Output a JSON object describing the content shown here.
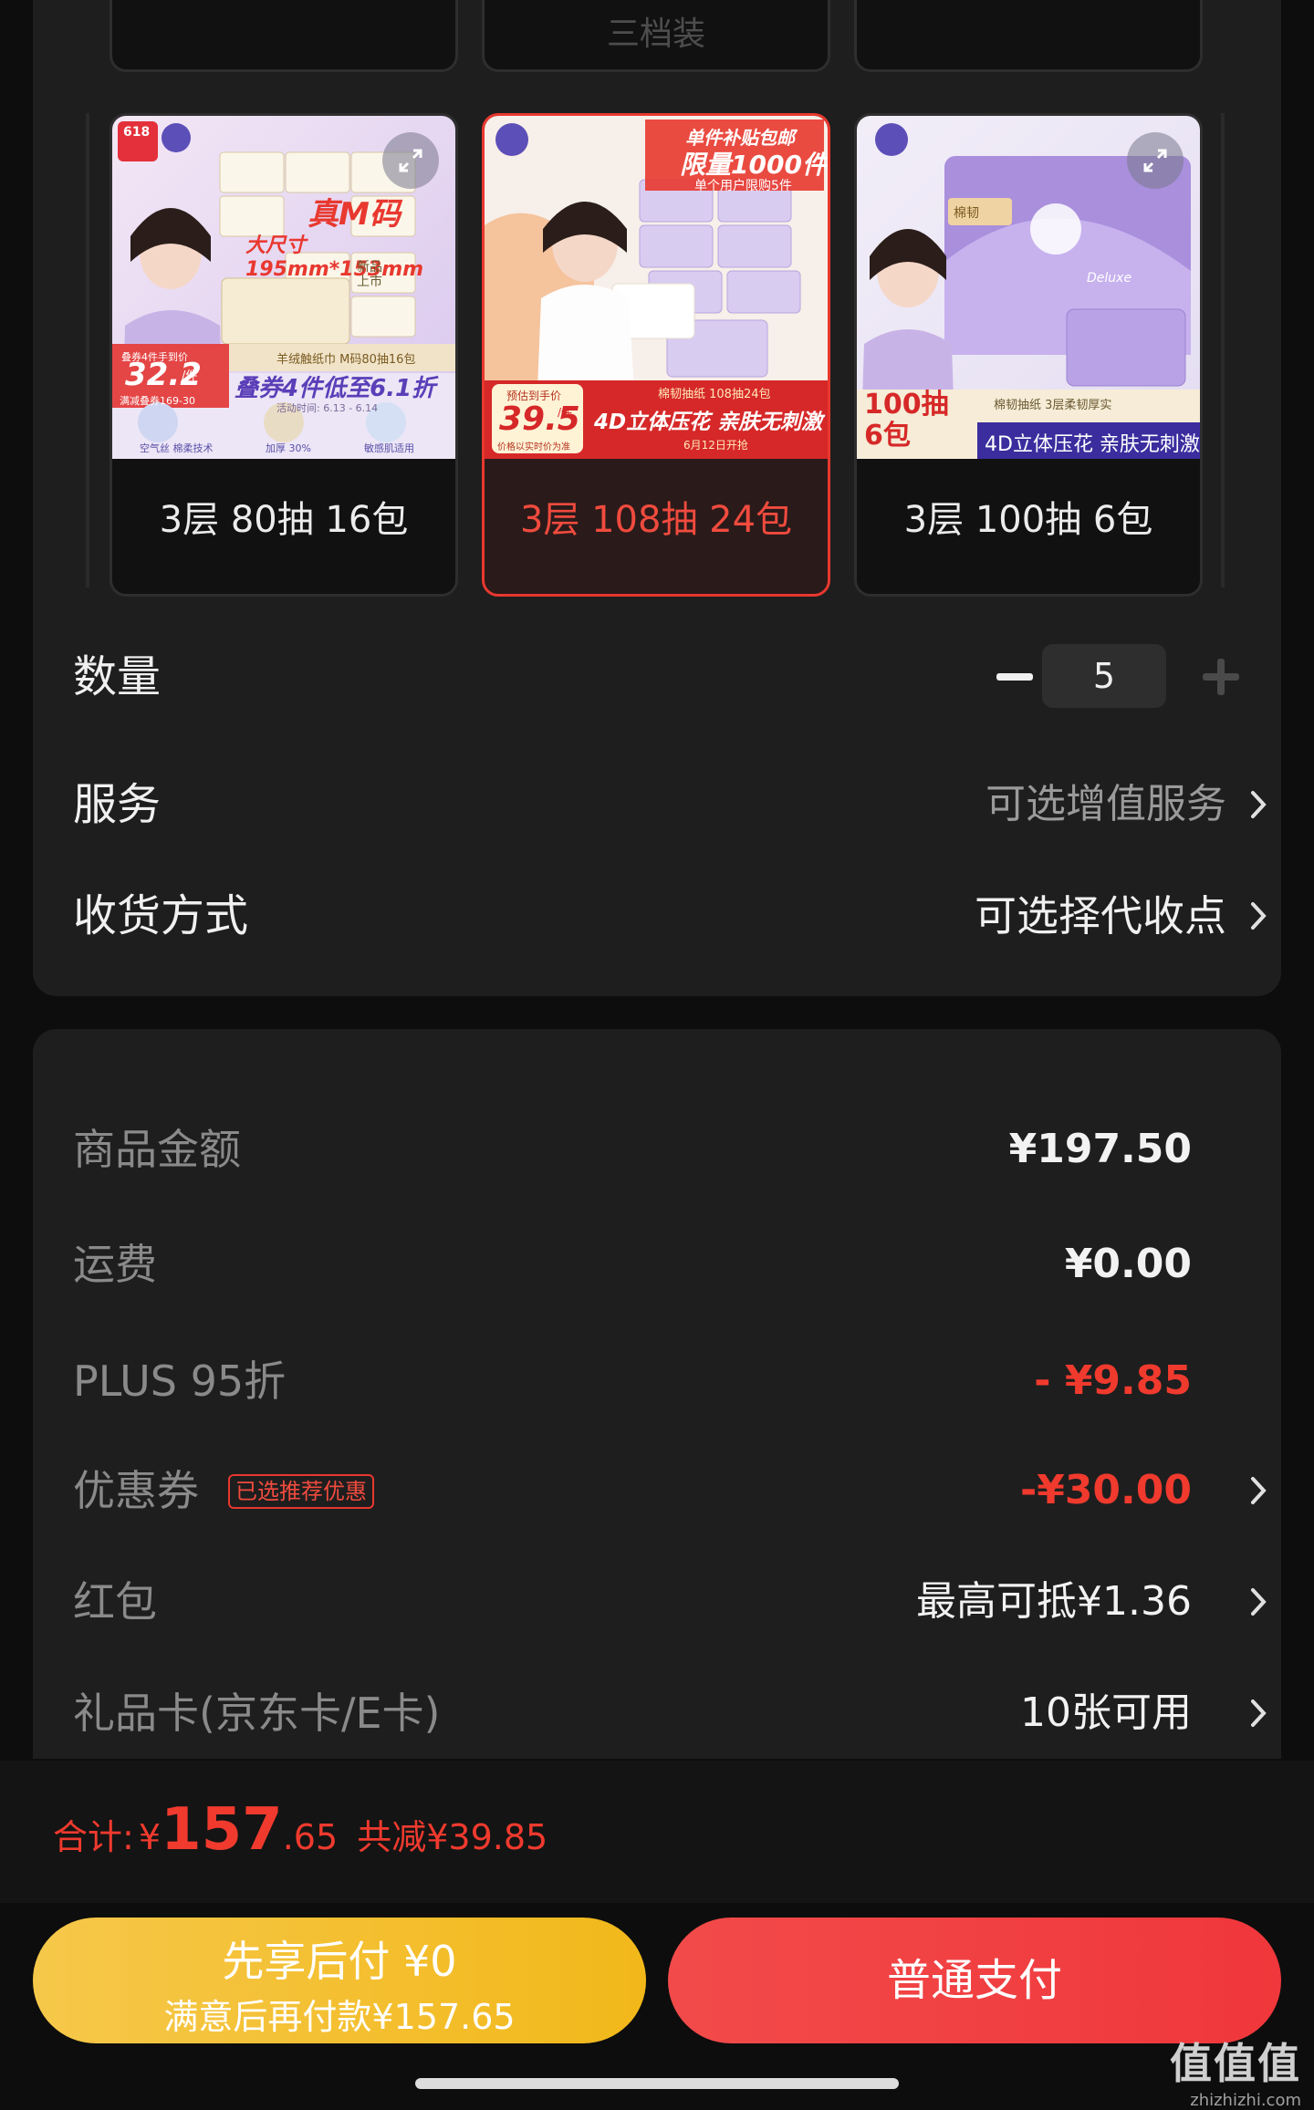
{
  "variant_selector": {
    "partial_top_label": "三档装",
    "options": [
      {
        "label": "3层 80抽 16包",
        "selected": false,
        "image": {
          "corner_badge": "618",
          "headline": "真M码",
          "size_text": "大尺寸195mm*153mm",
          "new_tag": "新品上市",
          "price_note": "叠券4件手到价",
          "price": "32.2",
          "price_unit": "/件",
          "coupon_text": "满减叠券169-30",
          "product_name": "羊绒触纸巾 M码80抽16包",
          "promo": "叠券4件低至6.1折",
          "date_range": "活动时间: 6.13 - 6.14",
          "features": [
            "空气丝 棉柔技术",
            "加厚 30%",
            "敏感肌适用"
          ]
        }
      },
      {
        "label": "3层 108抽 24包",
        "selected": true,
        "image": {
          "banner_top": "单件补贴包邮",
          "banner_main": "限量1000件",
          "banner_sub": "单个用户限购5件",
          "price_note": "预估到手价",
          "price": "39.5",
          "price_unit": "/件",
          "price_footnote": "价格以实时价为准",
          "product_name": "棉韧抽纸 108抽24包",
          "feature": "4D立体压花 亲肤无刺激",
          "date": "6月12日开抢"
        }
      },
      {
        "label": "3层 100抽 6包",
        "selected": false,
        "image": {
          "brand_tag": "棉韧",
          "deluxe": "Deluxe",
          "count_text": "100抽\n6包",
          "product_name": "棉韧抽纸 3层柔韧厚实",
          "feature": "4D立体压花 亲肤无刺激"
        }
      }
    ]
  },
  "quantity": {
    "label": "数量",
    "value": "5"
  },
  "service": {
    "label": "服务",
    "value": "可选增值服务"
  },
  "delivery": {
    "label": "收货方式",
    "value": "可选择代收点"
  },
  "price_breakdown": {
    "goods_amount": {
      "label": "商品金额",
      "value": "¥197.50"
    },
    "shipping": {
      "label": "运费",
      "value": "¥0.00"
    },
    "plus_discount": {
      "label": "PLUS 95折",
      "value": "- ¥9.85"
    },
    "coupon": {
      "label": "优惠券",
      "tag": "已选推荐优惠",
      "value": "-¥30.00"
    },
    "red_packet": {
      "label": "红包",
      "value": "最高可抵¥1.36"
    },
    "gift_card": {
      "label": "礼品卡(京东卡/E卡)",
      "value": "10张可用"
    }
  },
  "total": {
    "label": "合计:",
    "currency": "¥",
    "integer": "157",
    "decimal": ".65",
    "savings": "共减¥39.85"
  },
  "buttons": {
    "pay_later_title": "先享后付 ¥0",
    "pay_later_sub": "满意后再付款¥157.65",
    "normal_pay": "普通支付"
  },
  "watermark": {
    "brand": "值值值",
    "domain": "zhizhizhi.com"
  },
  "colors": {
    "accent_red": "#f03a2e",
    "pay_later_yellow": "#f2b81a",
    "pay_normal_red": "#f0373b",
    "card_bg": "#1e1e1e"
  }
}
